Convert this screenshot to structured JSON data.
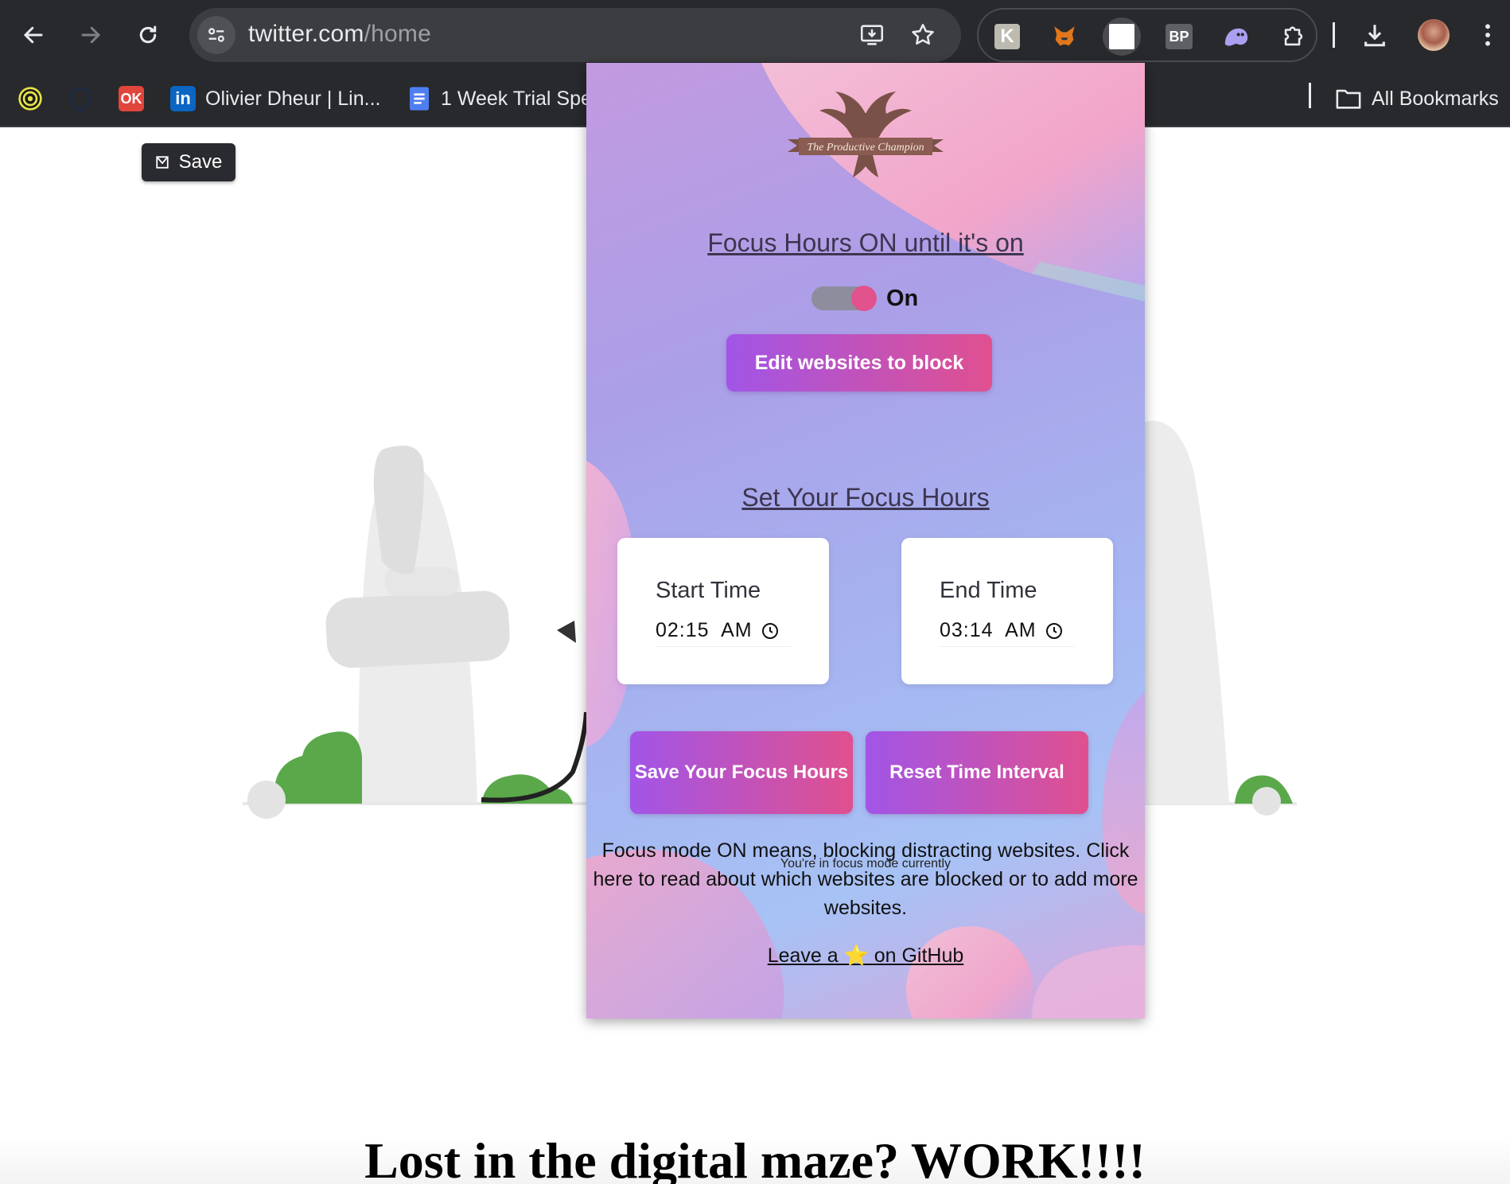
{
  "browser": {
    "url_host": "twitter.com",
    "url_path": "/home"
  },
  "bookmarks": {
    "items": [
      {
        "label": "",
        "icon": "target-icon"
      },
      {
        "label": "",
        "icon": "shield-icon"
      },
      {
        "label": "",
        "icon": "ok-icon",
        "icon_text": "OK"
      },
      {
        "label": "Olivier Dheur | Lin...",
        "icon": "linkedin-icon",
        "icon_text": "in"
      },
      {
        "label": "1 Week Trial Spe",
        "icon": "docs-icon"
      }
    ],
    "all_bookmarks_label": "All Bookmarks"
  },
  "extensions": {
    "bp_label": "BP",
    "k_label": "K"
  },
  "page": {
    "save_chip_label": "Save",
    "heading": "Lost in the digital maze? WORK!!!!"
  },
  "popup": {
    "logo_text": "The Productive Champion",
    "focus_title": "Focus Hours ON until it's on",
    "toggle_label": "On",
    "toggle_on": true,
    "edit_button": "Edit websites to block",
    "hours_title": "Set Your Focus Hours",
    "start": {
      "label": "Start Time",
      "value": "02:15  AM"
    },
    "end": {
      "label": "End Time",
      "value": "03:14  AM"
    },
    "save_button": "Save Your Focus Hours",
    "reset_button": "Reset Time Interval",
    "description": "Focus mode ON means, blocking distracting websites. Click here to read about which websites are blocked or to add more websites.",
    "status_overlay": "You're in focus mode currently",
    "github_link": "Leave a ⭐ on GitHub"
  },
  "colors": {
    "toolbar_bg": "#28292c",
    "button_gradient_start": "#a155e7",
    "button_gradient_end": "#e0508f",
    "toggle_knob": "#e2528c"
  }
}
